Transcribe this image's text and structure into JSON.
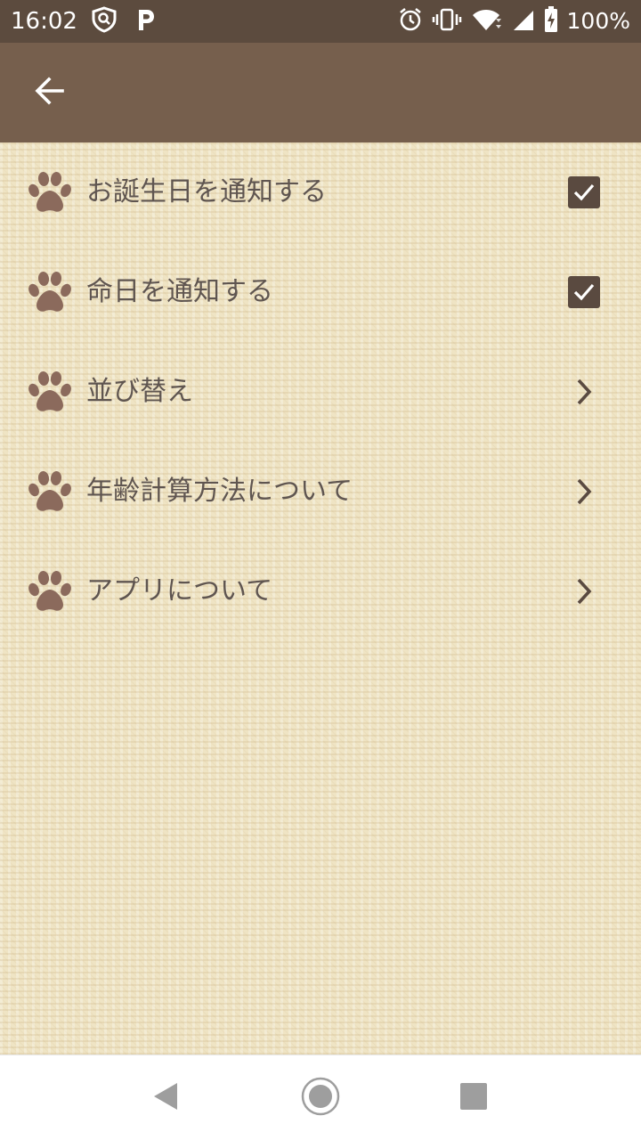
{
  "status_bar": {
    "time": "16:02",
    "battery_percent": "100%",
    "left_icons": [
      "vpn-shield-icon",
      "parking-icon"
    ],
    "right_icons": [
      "alarm-icon",
      "vibrate-icon",
      "wifi-icon",
      "signal-icon",
      "battery-charging-icon"
    ]
  },
  "app_bar": {
    "back_icon": "arrow-back-icon"
  },
  "settings": {
    "items": [
      {
        "label": "お誕生日を通知する",
        "control": "checkbox",
        "checked": true,
        "icon": "paw-icon"
      },
      {
        "label": "命日を通知する",
        "control": "checkbox",
        "checked": true,
        "icon": "paw-icon"
      },
      {
        "label": "並び替え",
        "control": "chevron",
        "icon": "paw-icon"
      },
      {
        "label": "年齢計算方法について",
        "control": "chevron",
        "icon": "paw-icon"
      },
      {
        "label": "アプリについて",
        "control": "chevron",
        "icon": "paw-icon"
      }
    ]
  },
  "nav_bar": {
    "icons": [
      "nav-back-icon",
      "nav-home-icon",
      "nav-recents-icon"
    ]
  },
  "colors": {
    "status_bar": "#5c4b3e",
    "app_bar": "#765f4d",
    "background": "#efe4c4",
    "paw": "#8b6a5c",
    "text": "#5f5550",
    "checkbox": "#5a4a40"
  }
}
